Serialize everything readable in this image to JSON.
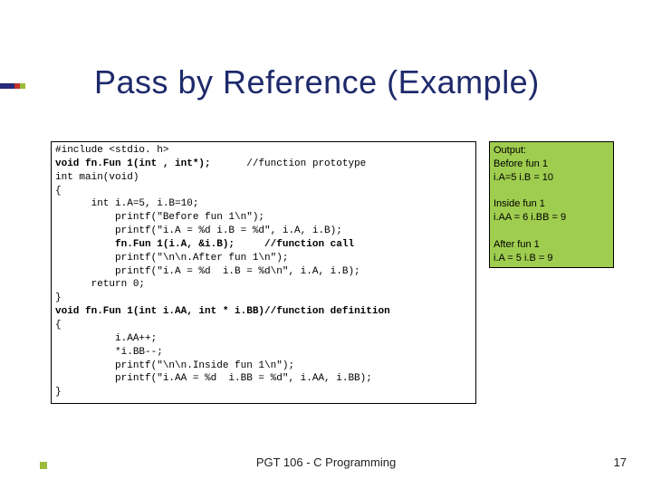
{
  "title": "Pass by Reference (Example)",
  "code": {
    "l01": "#include <stdio. h>",
    "l02a": "void fn.Fun 1(int , int*);",
    "l02b": "      //function prototype",
    "l03": "int main(void)",
    "l04": "{",
    "l05": "      int i.A=5, i.B=10;",
    "l06": "          printf(\"Before fun 1\\n\");",
    "l07": "          printf(\"i.A = %d i.B = %d\", i.A, i.B);",
    "l08a": "          fn.Fun 1(i.A, &i.B);",
    "l08b": "     //function call",
    "l09": "          printf(\"\\n\\n.After fun 1\\n\");",
    "l10": "          printf(\"i.A = %d  i.B = %d\\n\", i.A, i.B);",
    "l11": "      return 0;",
    "l12": "}",
    "l13a": "void fn.Fun 1(int i.AA, int * i.BB)",
    "l13b": "//function definition",
    "l14": "{",
    "l15": "          i.AA++;",
    "l16": "          *i.BB--;",
    "l17": "          printf(\"\\n\\n.Inside fun 1\\n\");",
    "l18": "          printf(\"i.AA = %d  i.BB = %d\", i.AA, i.BB);",
    "l19": "}"
  },
  "output": {
    "label": "Output:",
    "before": "Before fun 1\ni.A=5 i.B = 10",
    "inside": "Inside fun 1\ni.AA = 6 i.BB = 9",
    "after": "After fun 1\ni.A = 5 i.B = 9"
  },
  "footer": "PGT 106 - C Programming",
  "page_number": "17"
}
